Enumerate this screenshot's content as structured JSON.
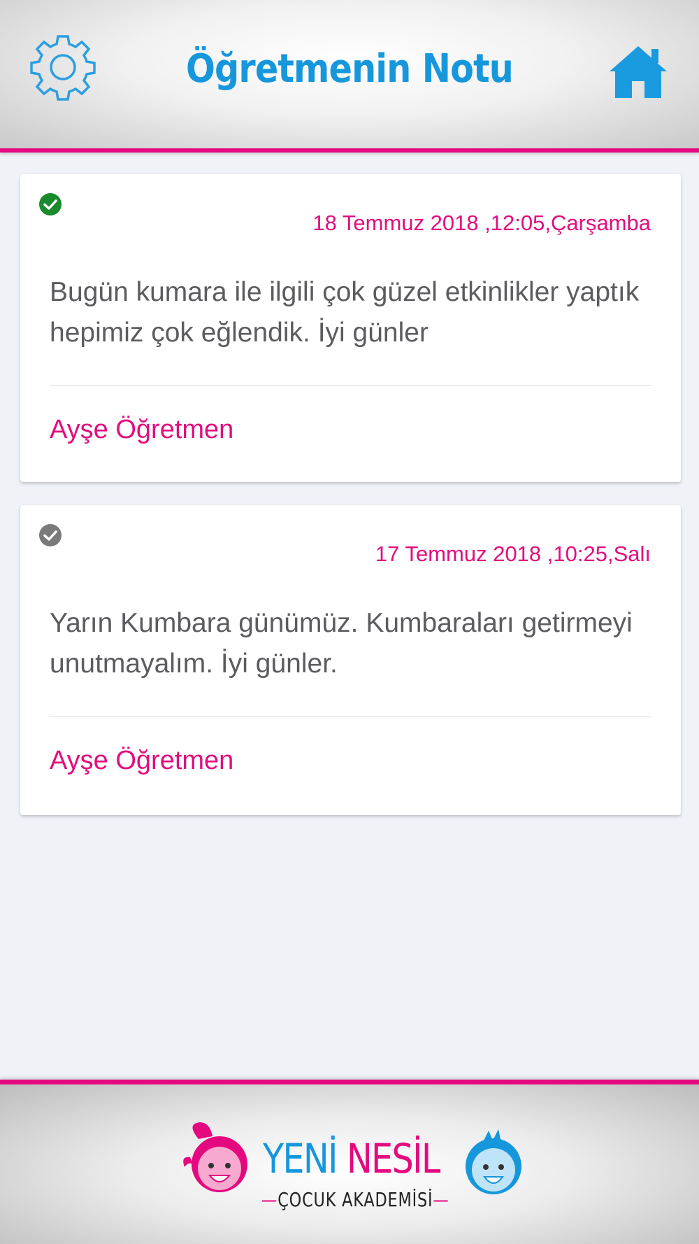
{
  "header": {
    "title": "Öğretmenin Notu",
    "settings_icon": "gear-icon",
    "home_icon": "home-icon"
  },
  "colors": {
    "accent_pink": "#e20d7e",
    "accent_blue": "#1697dc",
    "read_check": "#1a8a2e",
    "unread_check": "#7a7a7a"
  },
  "notes": [
    {
      "status_icon": "check-circle-icon",
      "date": "18 Temmuz 2018 ,12:05,Çarşamba",
      "message": "Bugün kumara ile ilgili çok güzel etkinlikler yaptık hepimiz çok eğlendik. İyi günler",
      "teacher": "Ayşe Öğretmen"
    },
    {
      "status_icon": "check-circle-icon",
      "date": "17 Temmuz 2018 ,10:25,Salı",
      "message": "Yarın Kumbara günümüz. Kumbaraları getirmeyi unutmayalım. İyi günler.",
      "teacher": "Ayşe Öğretmen"
    }
  ],
  "footer": {
    "logo_line1_a": "YENİ",
    "logo_line1_b": "NESİL",
    "logo_line2": "ÇOCUK AKADEMİSİ"
  }
}
